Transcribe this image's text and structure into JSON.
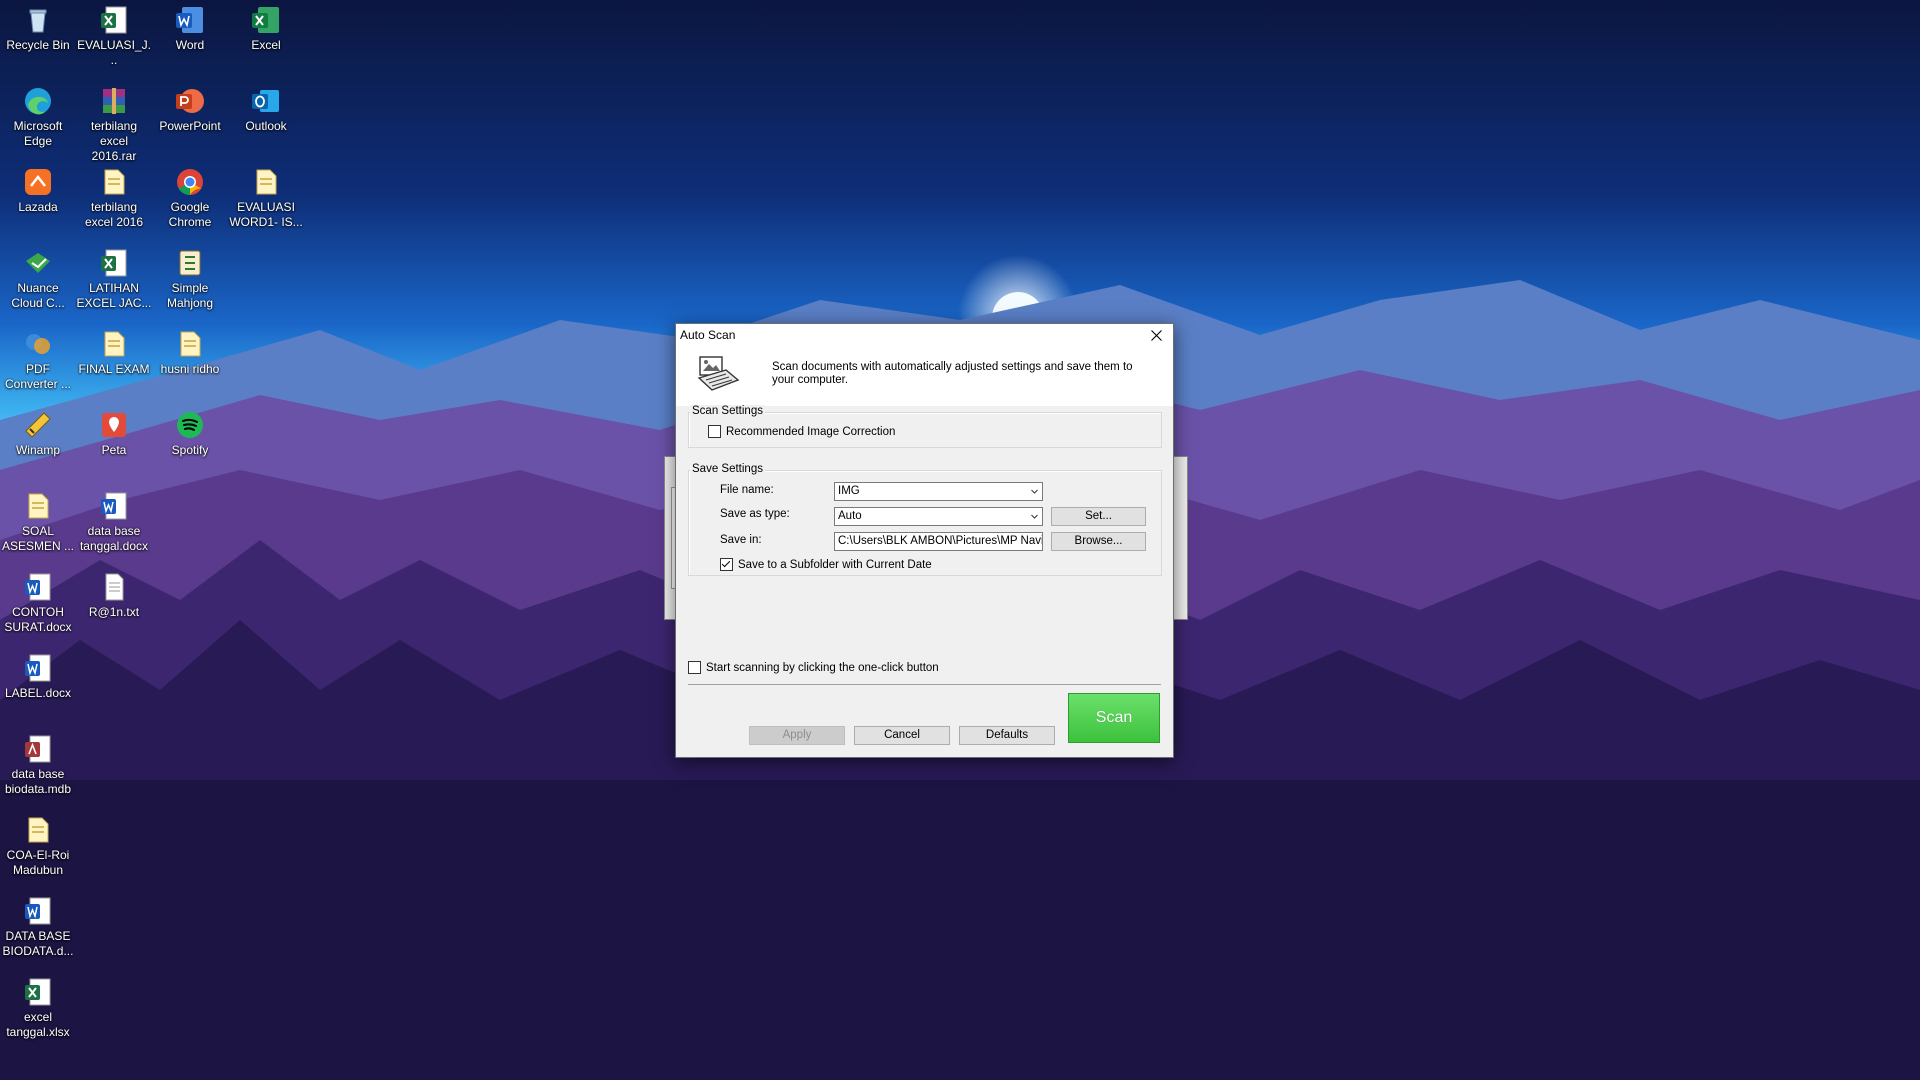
{
  "desktop": {
    "icons": [
      {
        "label": "Recycle Bin",
        "icon": "recycle-bin-icon"
      },
      {
        "label": "EVALUASI_J...",
        "icon": "excel-file-icon"
      },
      {
        "label": "Word",
        "icon": "word-app-icon"
      },
      {
        "label": "Excel",
        "icon": "excel-app-icon"
      },
      {
        "label": "Microsoft Edge",
        "icon": "edge-icon"
      },
      {
        "label": "terbilang excel 2016.rar",
        "icon": "winrar-archive-icon"
      },
      {
        "label": "PowerPoint",
        "icon": "powerpoint-app-icon"
      },
      {
        "label": "Outlook",
        "icon": "outlook-app-icon"
      },
      {
        "label": "Lazada",
        "icon": "lazada-icon"
      },
      {
        "label": "terbilang excel 2016",
        "icon": "folder-icon"
      },
      {
        "label": "Google Chrome",
        "icon": "chrome-icon"
      },
      {
        "label": "EVALUASI WORD1- IS...",
        "icon": "folder-icon"
      },
      {
        "label": "Nuance Cloud C...",
        "icon": "nuance-icon"
      },
      {
        "label": "LATIHAN EXCEL JAC...",
        "icon": "excel-file-icon"
      },
      {
        "label": "Simple Mahjong",
        "icon": "mahjong-icon"
      },
      {
        "label": "PDF Converter ...",
        "icon": "pdf-converter-icon"
      },
      {
        "label": "FINAL EXAM",
        "icon": "folder-icon"
      },
      {
        "label": "husni ridho",
        "icon": "folder-icon"
      },
      {
        "label": "Winamp",
        "icon": "winamp-icon"
      },
      {
        "label": "Peta",
        "icon": "map-pin-icon"
      },
      {
        "label": "Spotify",
        "icon": "spotify-icon"
      },
      {
        "label": "SOAL ASESMEN ...",
        "icon": "folder-icon"
      },
      {
        "label": "data base tanggal.docx",
        "icon": "word-file-icon"
      },
      {
        "label": "CONTOH SURAT.docx",
        "icon": "word-file-icon"
      },
      {
        "label": "R@1n.txt",
        "icon": "text-file-icon"
      },
      {
        "label": "LABEL.docx",
        "icon": "word-file-icon"
      },
      {
        "label": "data base biodata.mdb",
        "icon": "access-file-icon"
      },
      {
        "label": "COA-El-Roi Madubun",
        "icon": "folder-icon"
      },
      {
        "label": "DATA BASE BIODATA.d...",
        "icon": "word-file-icon"
      },
      {
        "label": "excel tanggal.xlsx",
        "icon": "excel-file-icon"
      }
    ]
  },
  "dialog": {
    "title": "Auto Scan",
    "description": "Scan documents with automatically adjusted settings and save them to your computer.",
    "scan_settings": {
      "title": "Scan Settings",
      "recommended_correction_label": "Recommended Image Correction",
      "recommended_correction_checked": false
    },
    "save_settings": {
      "title": "Save Settings",
      "file_name_label": "File name:",
      "file_name_value": "IMG",
      "save_as_type_label": "Save as type:",
      "save_as_type_value": "Auto",
      "set_button": "Set...",
      "save_in_label": "Save in:",
      "save_in_value": "C:\\Users\\BLK AMBON\\Pictures\\MP Navig",
      "browse_button": "Browse...",
      "subfolder_label": "Save to a Subfolder with Current Date",
      "subfolder_checked": true
    },
    "one_click_label": "Start scanning by clicking the one-click button",
    "one_click_checked": false,
    "buttons": {
      "apply": "Apply",
      "cancel": "Cancel",
      "defaults": "Defaults",
      "scan": "Scan"
    }
  },
  "colors": {
    "scan_button": "#4ccf4c",
    "sky_top": "#0a1a4a",
    "sky_horizon": "#2aa3e8",
    "mountains": "#6b4a9c"
  }
}
